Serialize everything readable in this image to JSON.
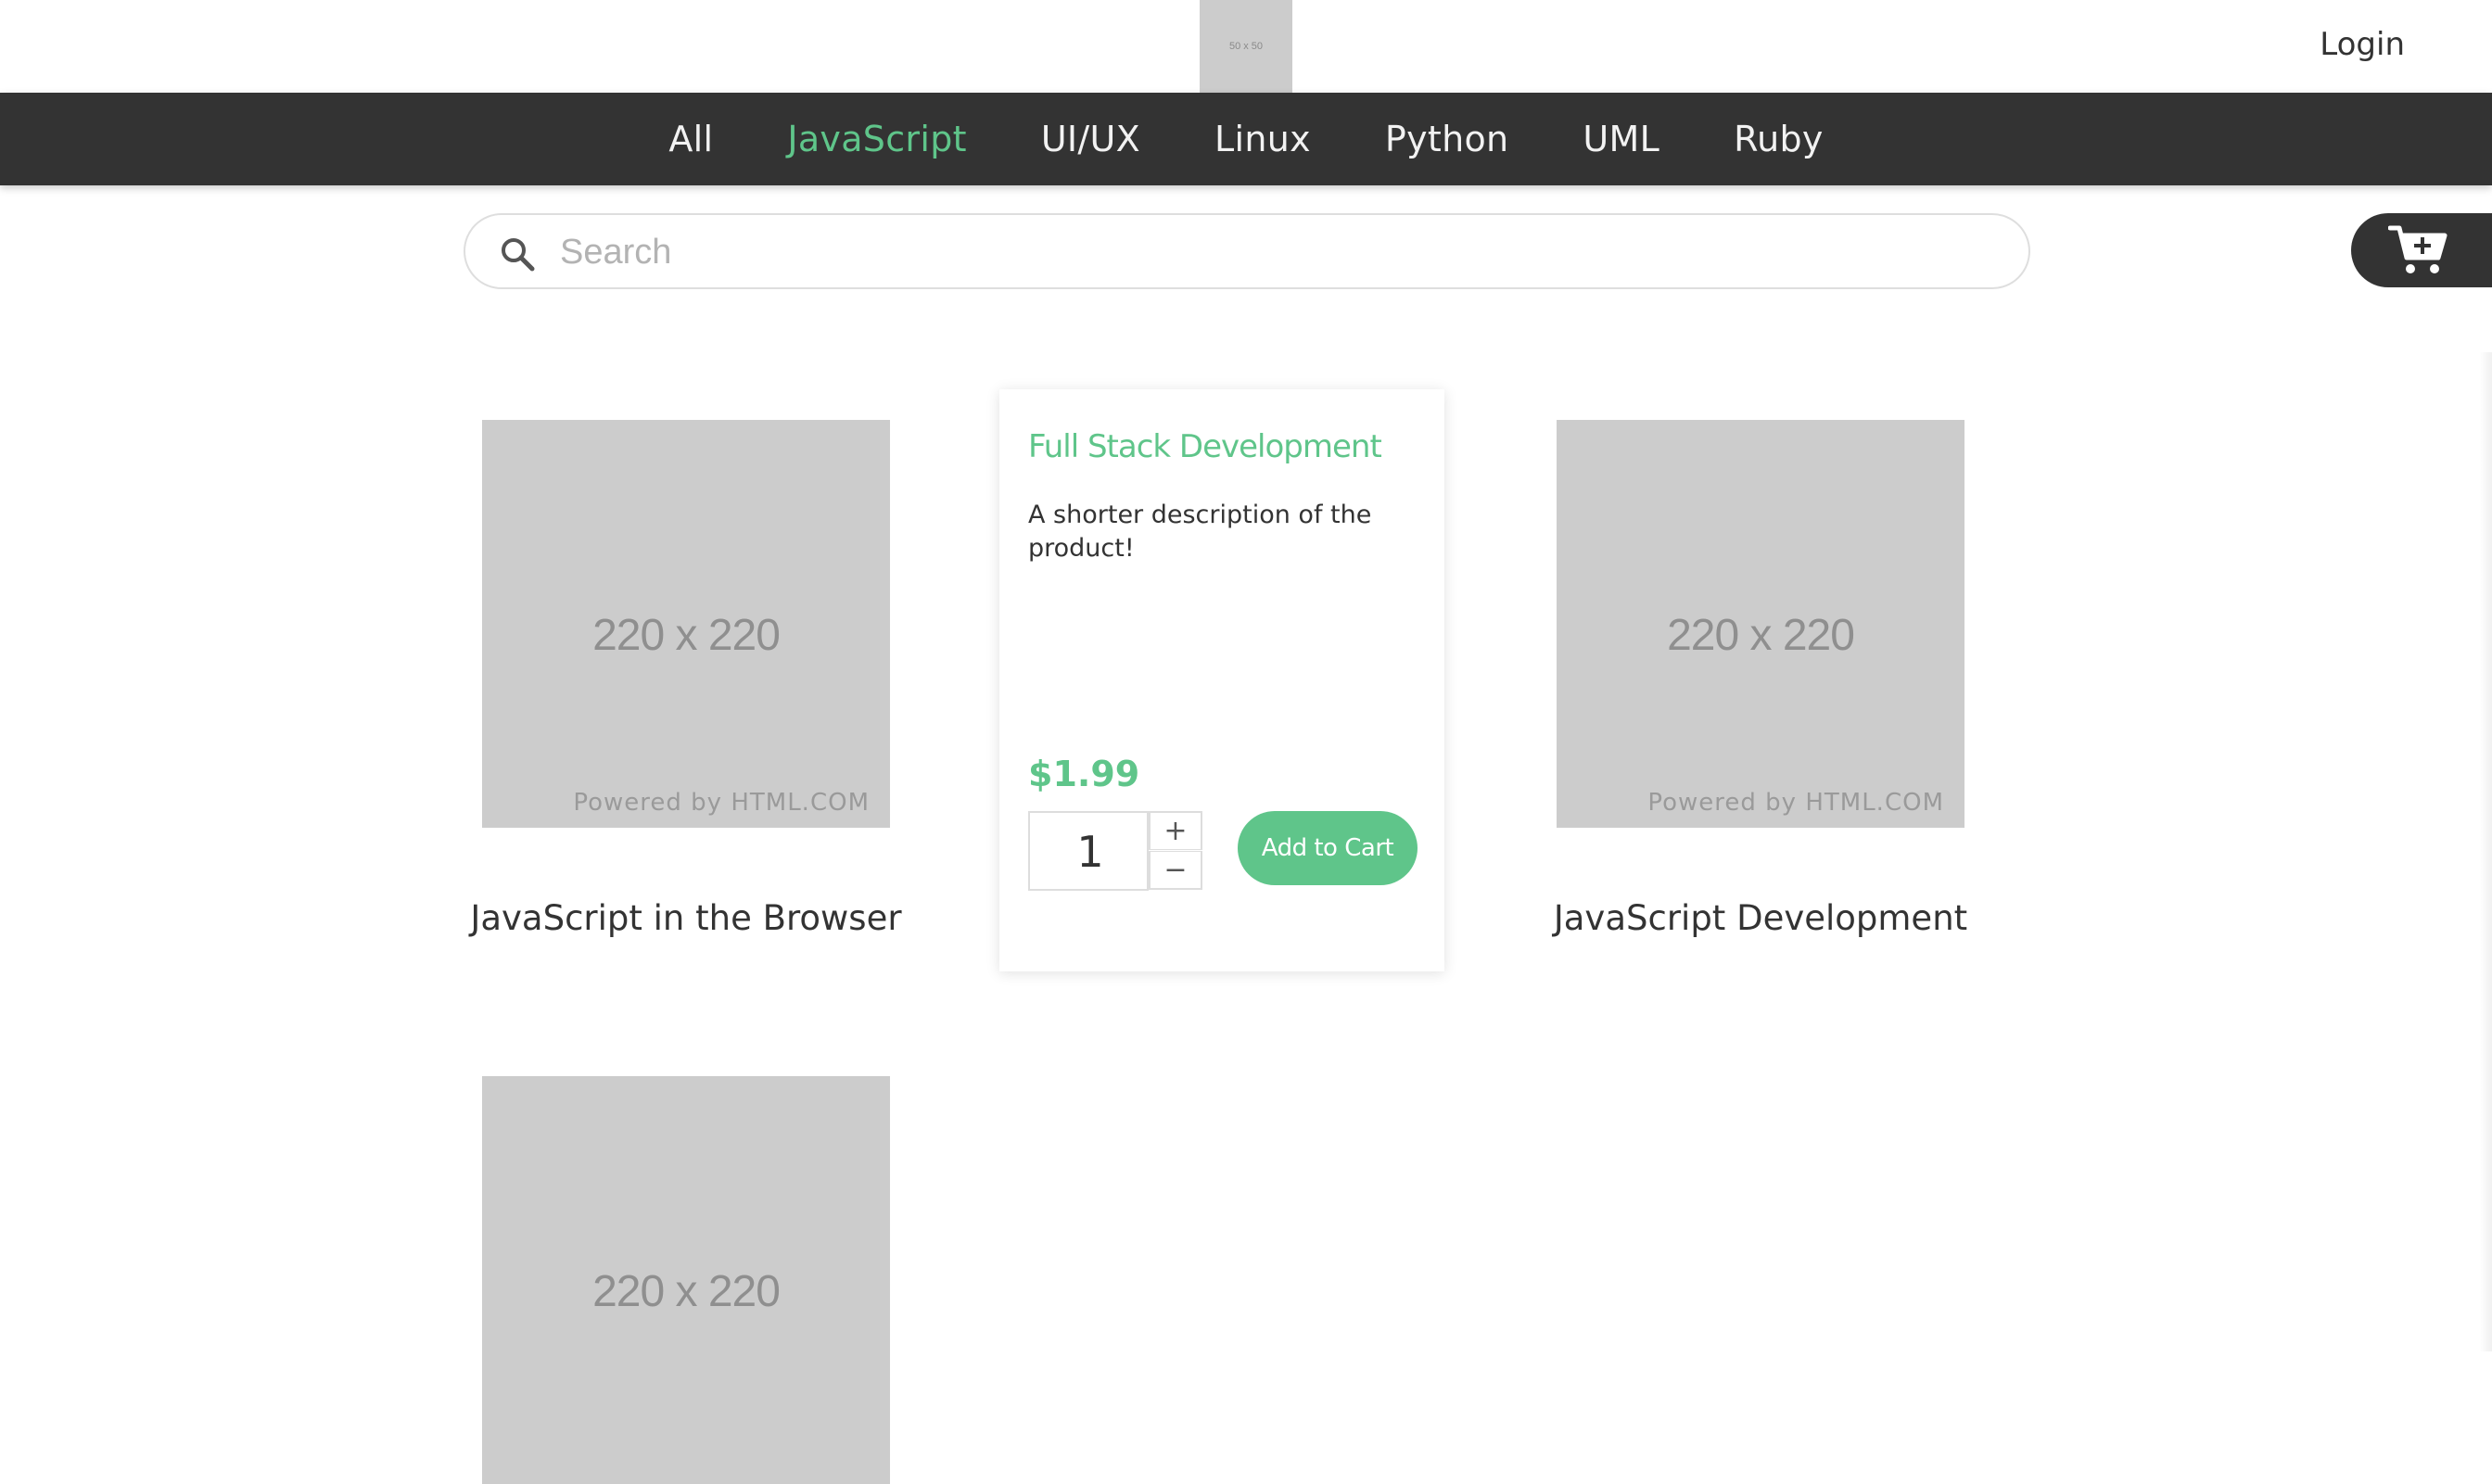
{
  "header": {
    "logo_text": "50 x 50",
    "login_label": "Login"
  },
  "nav": {
    "items": [
      {
        "label": "All",
        "active": false
      },
      {
        "label": "JavaScript",
        "active": true
      },
      {
        "label": "UI/UX",
        "active": false
      },
      {
        "label": "Linux",
        "active": false
      },
      {
        "label": "Python",
        "active": false
      },
      {
        "label": "UML",
        "active": false
      },
      {
        "label": "Ruby",
        "active": false
      }
    ]
  },
  "search": {
    "placeholder": "Search",
    "value": ""
  },
  "cart": {
    "icon": "cart-plus-icon"
  },
  "products": [
    {
      "title": "JavaScript in the Browser",
      "image_text": "220 x 220",
      "image_credit": "Powered by HTML.COM"
    },
    {
      "title": "JavaScript Development",
      "image_text": "220 x 220",
      "image_credit": "Powered by HTML.COM"
    },
    {
      "title": "",
      "image_text": "220 x 220",
      "image_credit": ""
    }
  ],
  "detail": {
    "title": "Full Stack Development",
    "description": "A shorter description of the product!",
    "price": "$1.99",
    "quantity": "1",
    "plus_label": "+",
    "minus_label": "−",
    "add_label": "Add to Cart"
  },
  "colors": {
    "accent": "#5fc58a",
    "nav_bg": "#333333",
    "placeholder_bg": "#cccccc"
  }
}
